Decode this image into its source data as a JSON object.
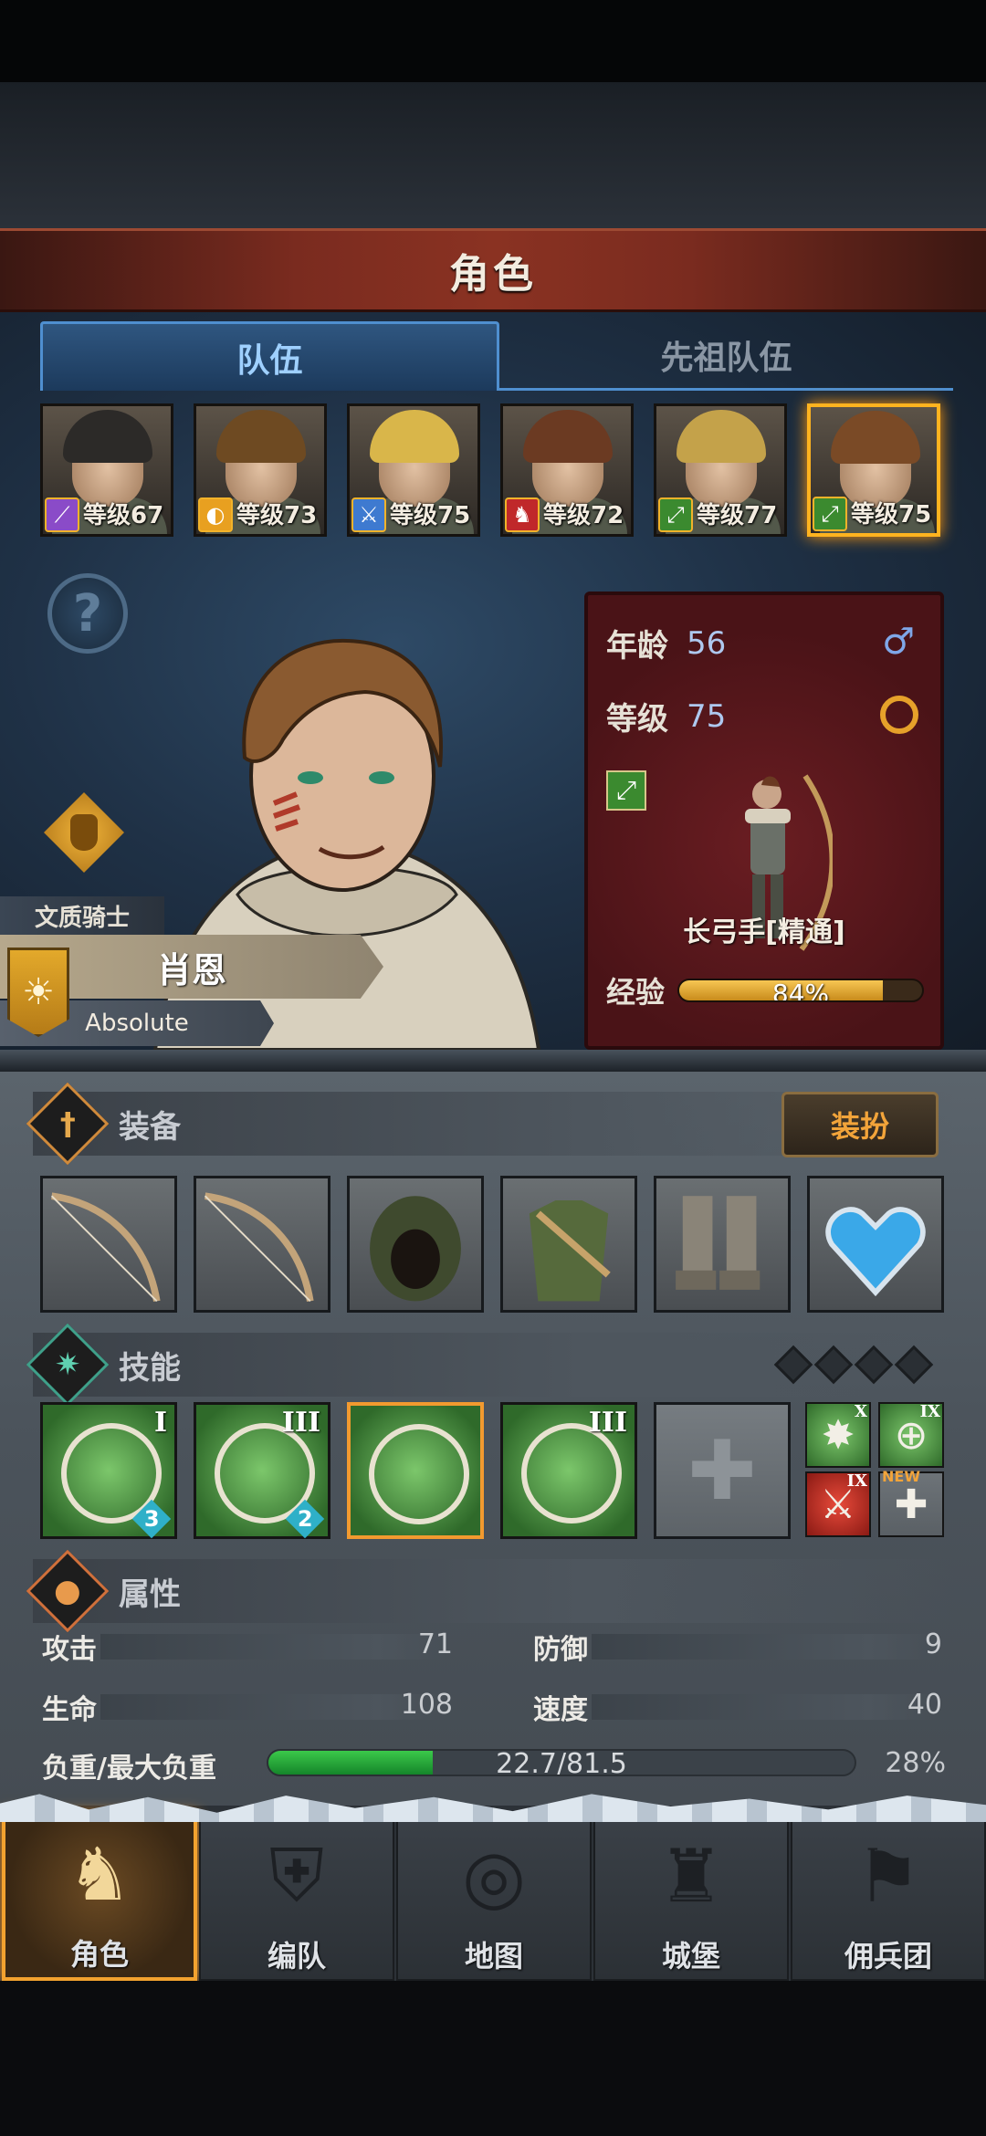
{
  "header": {
    "title": "角色"
  },
  "tabs": [
    {
      "label": "队伍",
      "active": true
    },
    {
      "label": "先祖队伍",
      "active": false
    }
  ],
  "party": [
    {
      "level_text": "等级67",
      "class_icon": "staff-icon",
      "badge_color": "#8a4bc8",
      "hair_color": "#2c2a28"
    },
    {
      "level_text": "等级73",
      "class_icon": "shield-icon",
      "badge_color": "#e8a020",
      "hair_color": "#6e4a22"
    },
    {
      "level_text": "等级75",
      "class_icon": "sword-icon",
      "badge_color": "#3e7ad0",
      "hair_color": "#d9b64a"
    },
    {
      "level_text": "等级72",
      "class_icon": "mount-icon",
      "badge_color": "#c0282a",
      "hair_color": "#6b3a22"
    },
    {
      "level_text": "等级77",
      "class_icon": "bow-icon",
      "badge_color": "#3b8a2f",
      "hair_color": "#c4a24a"
    },
    {
      "level_text": "等级75",
      "class_icon": "bow-icon",
      "badge_color": "#3b8a2f",
      "hair_color": "#7a4a26",
      "selected": true
    }
  ],
  "character": {
    "trait": "文质骑士",
    "name": "肖恩",
    "subtitle": "Absolute",
    "age_label": "年龄",
    "age": "56",
    "level_label": "等级",
    "level": "75",
    "gender_icon": "♂",
    "class_name": "长弓手[精通]",
    "exp_label": "经验",
    "exp_percent_text": "84%",
    "exp_fraction": 0.84
  },
  "equipment": {
    "title": "装备",
    "dress_button": "装扮",
    "slots": [
      {
        "icon": "longbow-icon"
      },
      {
        "icon": "longbow-icon"
      },
      {
        "icon": "hood-icon"
      },
      {
        "icon": "tunic-icon"
      },
      {
        "icon": "boots-icon"
      },
      {
        "icon": "heart-amulet-icon"
      }
    ]
  },
  "skills": {
    "title": "技能",
    "items": [
      {
        "icon": "target-arrow-icon",
        "rank": "I",
        "count": "3"
      },
      {
        "icon": "multi-arrow-icon",
        "rank": "III",
        "count": "2"
      },
      {
        "icon": "crippling-shot-icon",
        "rank": "",
        "count": ""
      },
      {
        "icon": "target-volley-icon",
        "rank": "III",
        "count": ""
      }
    ],
    "minor": [
      {
        "icon": "burst-icon",
        "rank": "X"
      },
      {
        "icon": "crosshair-icon",
        "rank": "IX"
      },
      {
        "icon": "red-sword-icon",
        "rank": "IX"
      },
      {
        "icon": "empty-cross-icon",
        "rank": "",
        "badge": "NEW"
      }
    ]
  },
  "attributes": {
    "title": "属性",
    "attack_label": "攻击",
    "attack": "71",
    "defense_label": "防御",
    "defense": "9",
    "hp_label": "生命",
    "hp": "108",
    "speed_label": "速度",
    "speed": "40",
    "load_label": "负重/最大负重",
    "load_text": "22.7/81.5",
    "load_percent_text": "28%",
    "load_fraction": 0.28
  },
  "nav": [
    {
      "label": "角色",
      "icon": "knight-icon",
      "active": true
    },
    {
      "label": "编队",
      "icon": "helmet-icon",
      "active": false
    },
    {
      "label": "地图",
      "icon": "compass-icon",
      "active": false
    },
    {
      "label": "城堡",
      "icon": "castle-icon",
      "active": false
    },
    {
      "label": "佣兵团",
      "icon": "banner-icon",
      "active": false
    }
  ]
}
